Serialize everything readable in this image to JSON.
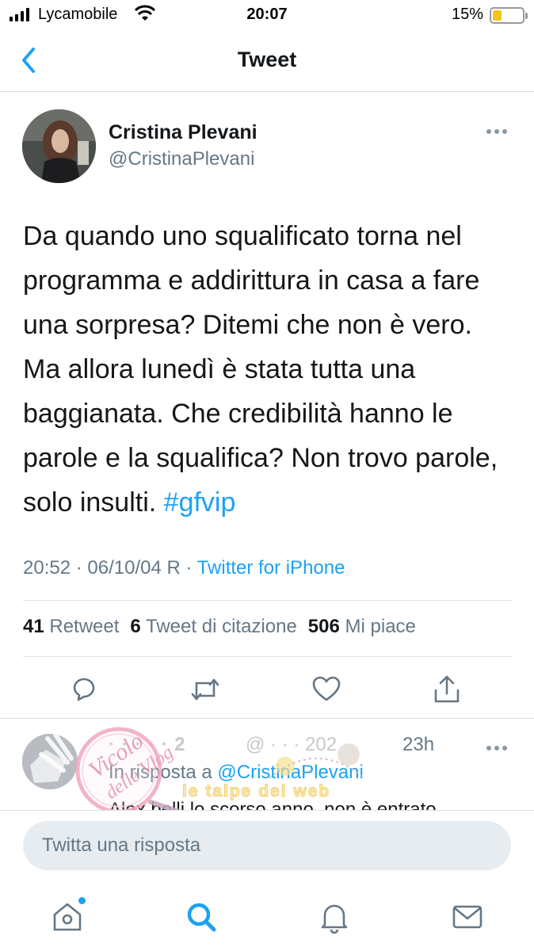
{
  "status_bar": {
    "carrier": "Lycamobile",
    "time": "20:07",
    "battery_percent": "15%",
    "battery_level": 0.15,
    "battery_color": "#f5c518"
  },
  "nav": {
    "title": "Tweet",
    "back_icon": "chevron-left-icon"
  },
  "tweet": {
    "author_name": "Cristina Plevani",
    "author_handle": "@CristinaPlevani",
    "text": "Da quando uno squalificato torna nel programma e addirittura in casa a fare una sorpresa? Ditemi che non è vero. Ma allora lunedì è stata tutta una baggianata. Che credibilità hanno le parole e la squalifica? Non trovo parole, solo insulti.",
    "hashtag": "#gfvip",
    "timestamp": "20:52 · 06/10/04 R · ",
    "source": "Twitter for iPhone",
    "stats": {
      "retweets_count": "41",
      "retweets_label": "Retweet",
      "quotes_count": "6",
      "quotes_label": "Tweet di citazione",
      "likes_count": "506",
      "likes_label": "Mi piace"
    },
    "actions": [
      "reply-icon",
      "retweet-icon",
      "like-icon",
      "share-icon"
    ]
  },
  "reply_preview": {
    "author_name": "· ·  · ·  ·  2",
    "author_handle": "@ ·  ·  ·  202",
    "time": "23h",
    "context_prefix": "In risposta a ",
    "context_mention": "@CristinaPlevani",
    "body": "Alex belli lo scorso anno, non è entrato"
  },
  "watermark": {
    "text": "le talpe del web"
  },
  "composer": {
    "placeholder": "Twitta una risposta"
  },
  "tab_bar": {
    "tabs": [
      "home-icon",
      "search-icon",
      "notifications-icon",
      "messages-icon"
    ],
    "active_color": "#1da1f2"
  },
  "colors": {
    "accent": "#1da1f2",
    "secondary_text": "#657786",
    "primary_text": "#14171a"
  }
}
